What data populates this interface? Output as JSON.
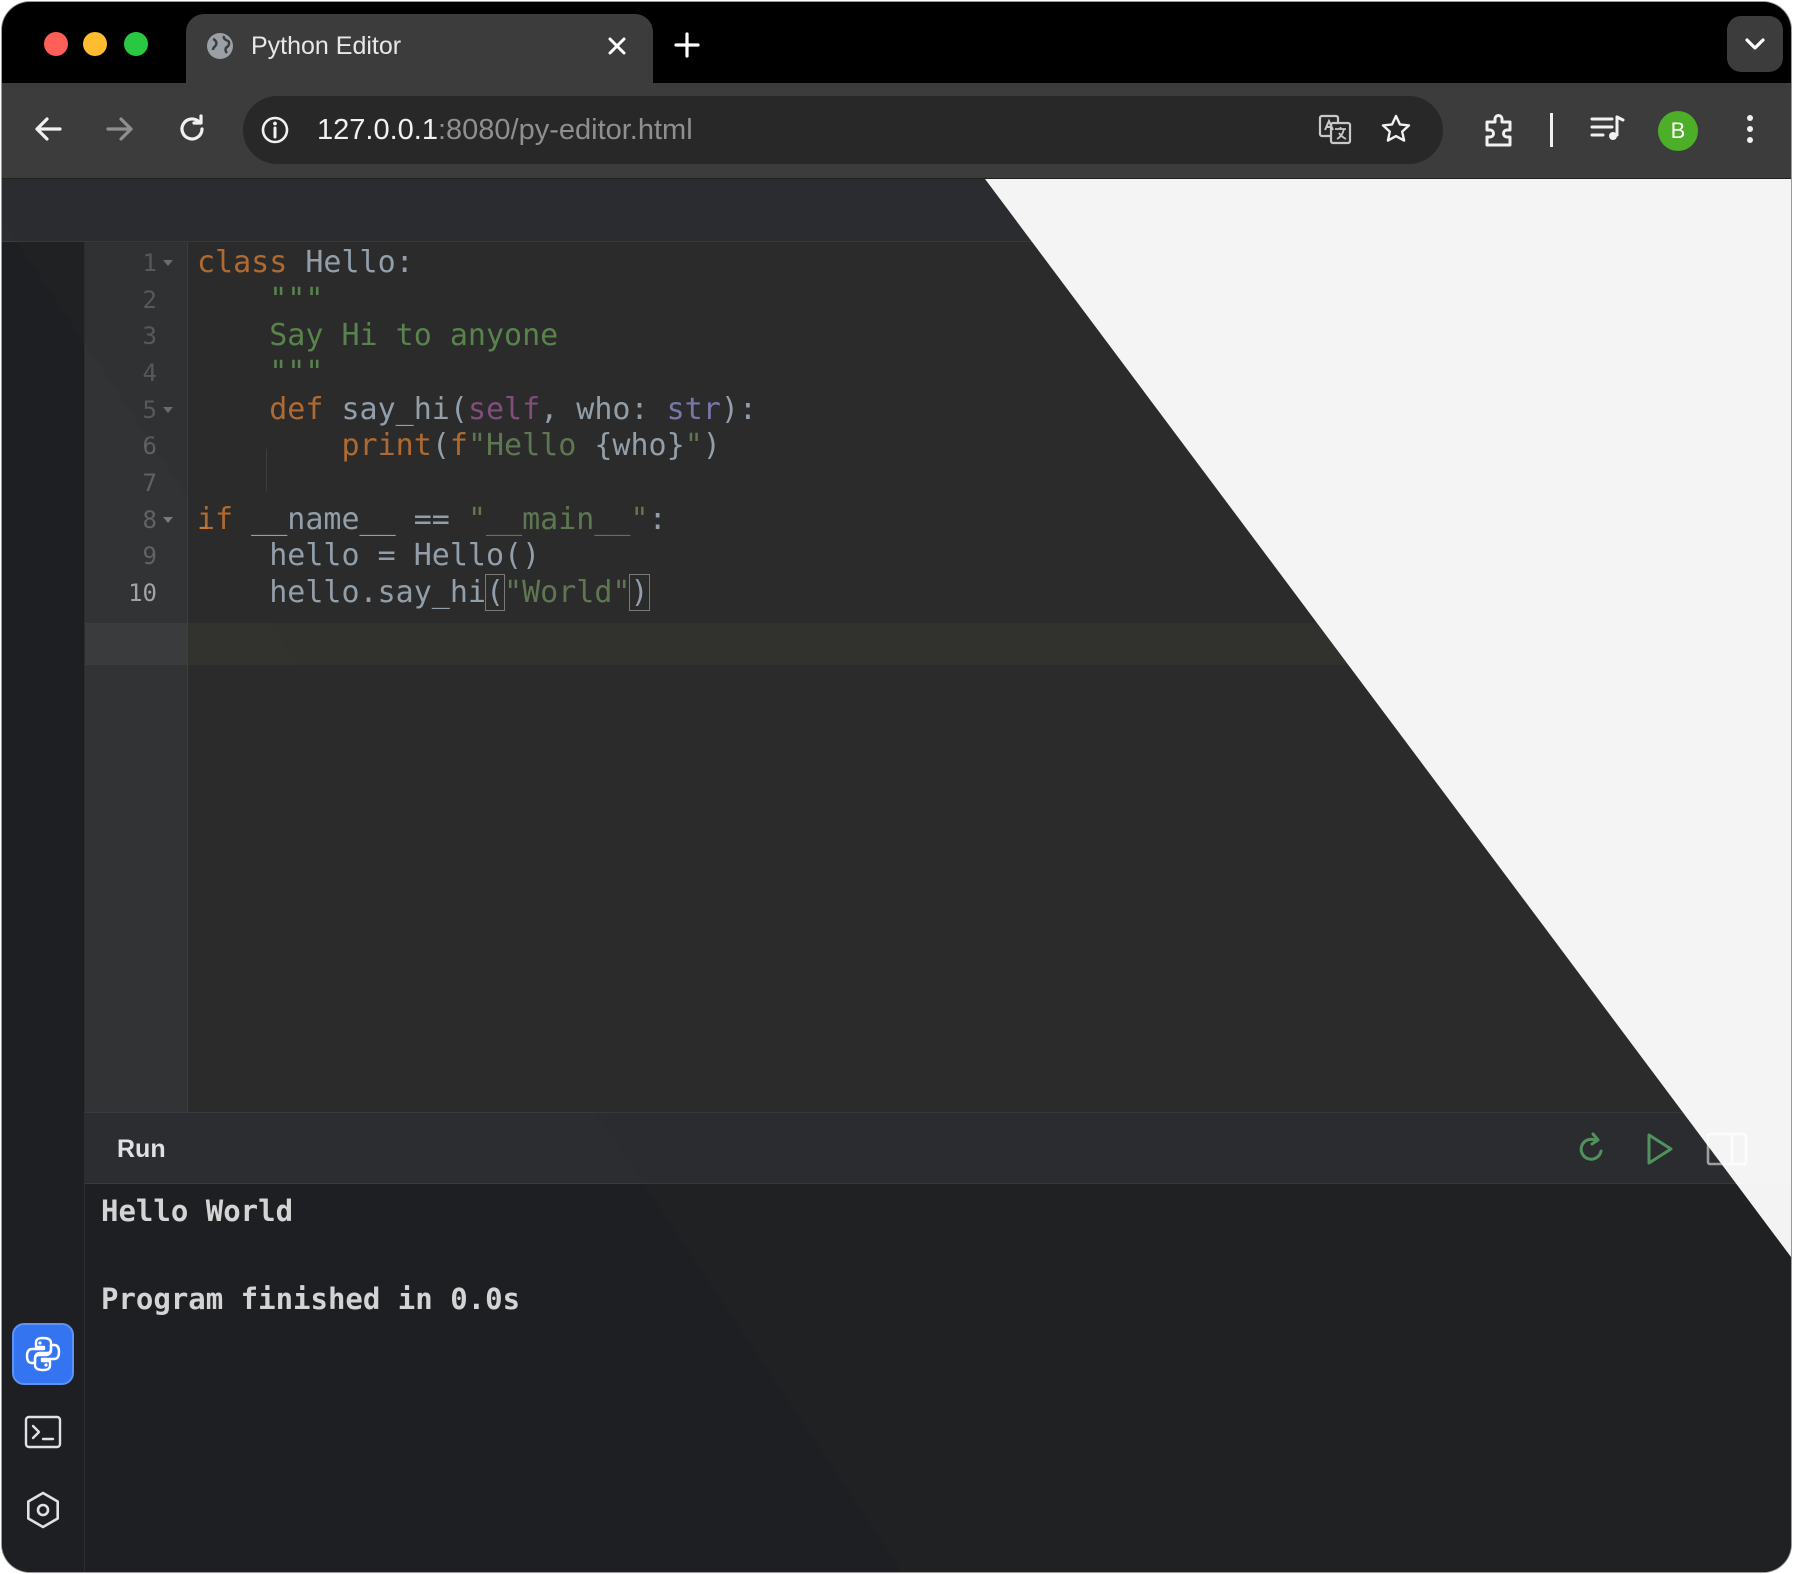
{
  "browser": {
    "tab_title": "Python Editor",
    "url_host": "127.0.0.1",
    "url_rest": ":8080/py-editor.html",
    "avatar_letter": "B"
  },
  "editor": {
    "line_numbers": [
      "1",
      "2",
      "3",
      "4",
      "5",
      "6",
      "7",
      "8",
      "9",
      "10"
    ],
    "code": {
      "l1_kw": "class",
      "l1_rest": " Hello:",
      "l2": "    \"\"\"",
      "l3": "    Say Hi to anyone",
      "l4": "    \"\"\"",
      "l5_indent": "    ",
      "l5_kw": "def",
      "l5_name": " say_hi(",
      "l5_self": "self",
      "l5_mid": ", who: ",
      "l5_type": "str",
      "l5_end": "):",
      "l6_indent": "        ",
      "l6_fn": "print",
      "l6_open": "(",
      "l6_fpre": "f",
      "l6_str1": "\"Hello ",
      "l6_expr": "{who}",
      "l6_str2": "\"",
      "l6_close": ")",
      "l8_kw": "if",
      "l8_mid": " __name__ == ",
      "l8_str": "\"__main__\"",
      "l8_end": ":",
      "l9": "    hello = Hello()",
      "l10_pre": "    hello.say_hi",
      "l10_open": "(",
      "l10_str": "\"World\"",
      "l10_close": ")"
    }
  },
  "run_panel": {
    "title": "Run",
    "output_line1": "Hello World",
    "output_line2": "Program finished in 0.0s"
  },
  "colors": {
    "keyword": "#cc7832",
    "string": "#6a8759",
    "self": "#94558d",
    "builtin_type": "#8888c6",
    "run_green": "#59a869",
    "python_button": "#3574f0"
  },
  "icons": {
    "sidebar": [
      "python-icon",
      "terminal-icon",
      "settings-icon"
    ],
    "run_toolbar": [
      "rerun-icon",
      "play-icon",
      "split-layout-icon"
    ]
  }
}
